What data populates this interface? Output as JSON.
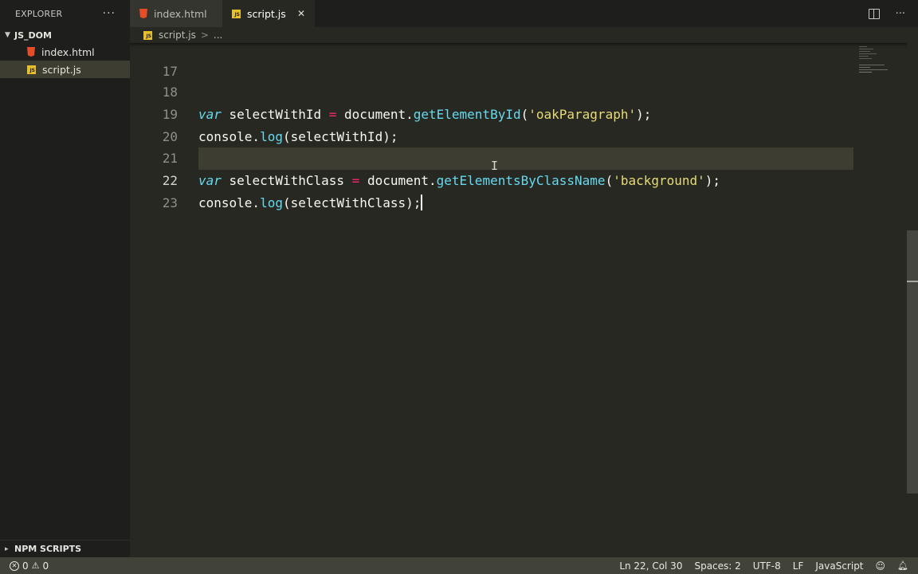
{
  "sidebar": {
    "title": "EXPLORER",
    "more_label": "···",
    "folder": "JS_DOM",
    "files": [
      {
        "name": "index.html",
        "type": "html"
      },
      {
        "name": "script.js",
        "type": "js"
      }
    ],
    "npm_scripts": "NPM SCRIPTS"
  },
  "tabs": [
    {
      "label": "index.html",
      "type": "html"
    },
    {
      "label": "script.js",
      "type": "js",
      "close": "✕"
    }
  ],
  "breadcrumb": {
    "file": "script.js",
    "separator": ">",
    "rest": "..."
  },
  "editor": {
    "lines": [
      {
        "number": "17",
        "code": ""
      },
      {
        "number": "18",
        "code": "var selectWithId = document.getElementById('oakParagraph');"
      },
      {
        "number": "19",
        "code": "console.log(selectWithId);"
      },
      {
        "number": "20",
        "code": ""
      },
      {
        "number": "21",
        "code": "var selectWithClass = document.getElementsByClassName('background');"
      },
      {
        "number": "22",
        "code": "console.log(selectWithClass);"
      },
      {
        "number": "23",
        "code": ""
      }
    ]
  },
  "status": {
    "errors": "0",
    "warnings": "0",
    "position": "Ln 22, Col 30",
    "spaces": "Spaces: 2",
    "encoding": "UTF-8",
    "eol": "LF",
    "language": "JavaScript"
  },
  "colors": {
    "background": "#272822",
    "keyword": "#66d9ef",
    "operator": "#f92672",
    "string": "#e6db74",
    "statusbar": "#414339"
  }
}
